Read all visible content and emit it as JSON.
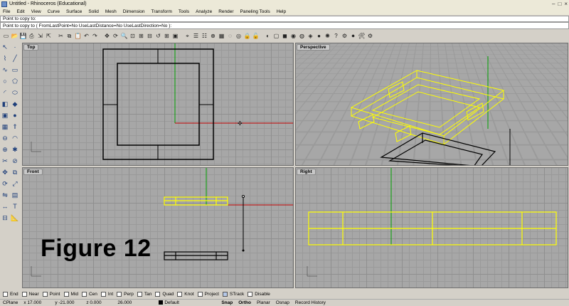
{
  "window": {
    "title": "Untitled - Rhinoceros (Educational)"
  },
  "menu": [
    "File",
    "Edit",
    "View",
    "Curve",
    "Surface",
    "Solid",
    "Mesh",
    "Dimension",
    "Transform",
    "Tools",
    "Analyze",
    "Render",
    "Paneling Tools",
    "Help"
  ],
  "command": {
    "history": "Point to copy to:",
    "prompt": "Point to copy to ( FromLastPoint=No  UseLastDistance=No  UseLastDirection=No ): "
  },
  "toolbar_icons": [
    "new-icon",
    "open-icon",
    "save-icon",
    "print-icon",
    "import-icon",
    "export-icon",
    "cut-icon",
    "copy-icon",
    "paste-icon",
    "undo-icon",
    "redo-icon",
    "pan-icon",
    "rotate-view-icon",
    "zoom-icon",
    "zoom-window-icon",
    "zoom-extents-icon",
    "zoom-selected-icon",
    "undo-view-icon",
    "four-view-icon",
    "set-view-icon",
    "cplane-icon",
    "layer-icon",
    "properties-icon",
    "object-snap-icon",
    "select-all-icon",
    "hide-icon",
    "show-icon",
    "lock-icon",
    "unlock-icon",
    "render-icon",
    "wireframe-icon",
    "shaded-icon",
    "rendered-icon",
    "ghosted-icon",
    "xray-icon",
    "material-icon",
    "light-icon",
    "help-icon",
    "options-icon",
    "record-icon",
    "tools-icon",
    "gear-icon"
  ],
  "sidebar_icons": [
    "select-icon",
    "point-icon",
    "polyline-icon",
    "line-icon",
    "curve-icon",
    "rectangle-icon",
    "circle-icon",
    "polygon-icon",
    "arc-icon",
    "ellipse-icon",
    "surface-icon",
    "solid-icon",
    "box-icon",
    "sphere-icon",
    "mesh-icon",
    "extrude-icon",
    "boolean-icon",
    "fillet-icon",
    "join-icon",
    "explode-icon",
    "trim-icon",
    "split-icon",
    "move-icon",
    "copy-tool-icon",
    "rotate-icon",
    "scale-icon",
    "mirror-icon",
    "array-icon",
    "dimension-icon",
    "text-icon",
    "group-icon",
    "analyze-icon"
  ],
  "viewports": {
    "top": {
      "title": "Top"
    },
    "perspective": {
      "title": "Perspective"
    },
    "front": {
      "title": "Front"
    },
    "right": {
      "title": "Right"
    }
  },
  "figure_label": "Figure 12",
  "osnaps": [
    {
      "label": "End",
      "checked": false
    },
    {
      "label": "Near",
      "checked": false
    },
    {
      "label": "Point",
      "checked": false
    },
    {
      "label": "Mid",
      "checked": false
    },
    {
      "label": "Cen",
      "checked": false
    },
    {
      "label": "Int",
      "checked": false
    },
    {
      "label": "Perp",
      "checked": false
    },
    {
      "label": "Tan",
      "checked": false
    },
    {
      "label": "Quad",
      "checked": false
    },
    {
      "label": "Knot",
      "checked": false
    },
    {
      "label": "Project",
      "checked": false
    },
    {
      "label": "STrack",
      "checked": true
    },
    {
      "label": "Disable",
      "checked": false
    }
  ],
  "status": {
    "cplane": "CPlane",
    "x": "x 17.000",
    "y": "y -21.000",
    "z": "z 0.000",
    "distance": "26.000",
    "layer": "Default",
    "snap": "Snap",
    "ortho": "Ortho",
    "planar": "Planar",
    "osnap": "Osnap",
    "record_history": "Record History"
  },
  "colors": {
    "selected": "#ffff00",
    "x_axis": "#c00000",
    "y_axis": "#00a000",
    "viewport_bg": "#a7a7a7"
  }
}
